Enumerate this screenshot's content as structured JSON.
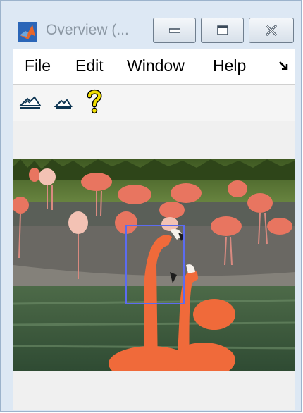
{
  "window": {
    "title": "Overview (...",
    "controls": {
      "minimize_icon": "minimize-icon",
      "maximize_icon": "maximize-icon",
      "close_icon": "close-icon"
    }
  },
  "menu": {
    "items": [
      {
        "label": "File"
      },
      {
        "label": "Edit"
      },
      {
        "label": "Window"
      },
      {
        "label": "Help"
      }
    ],
    "overflow_icon": "dock-arrow-icon"
  },
  "toolbar": {
    "tools": [
      {
        "icon": "zoom-in-mountain-icon"
      },
      {
        "icon": "zoom-out-mountain-icon"
      },
      {
        "icon": "help-question-icon",
        "color": "#e6d000"
      }
    ]
  },
  "image": {
    "subject": "flamingos-photo",
    "detail_rect_color": "#5c6cf0"
  },
  "colors": {
    "window_frame": "#dde8f4",
    "menubar_bg": "#ffffff",
    "toolbar_bg": "#f5f5f5",
    "panel_bg": "#f0f0f0"
  }
}
